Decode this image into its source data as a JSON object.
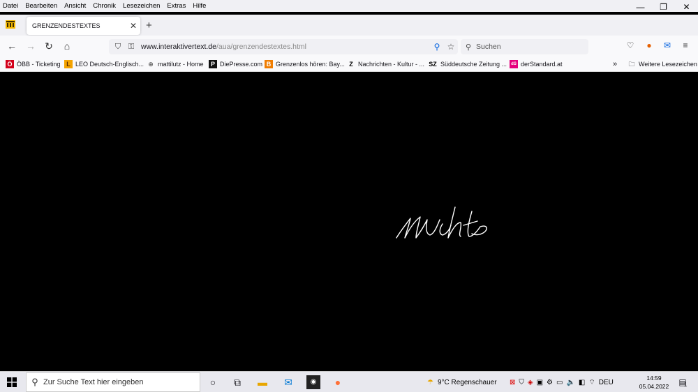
{
  "menubar": {
    "items": [
      "Datei",
      "Bearbeiten",
      "Ansicht",
      "Chronik",
      "Lesezeichen",
      "Extras",
      "Hilfe"
    ]
  },
  "window_controls": {
    "minimize": "—",
    "restore": "❐",
    "close": "✕"
  },
  "tab": {
    "title": "GRENZENDESTEXTES",
    "close": "✕",
    "new": "+"
  },
  "nav": {
    "url_domain": "www.interaktivertext.de",
    "url_path": "/aua/grenzendestextes.html",
    "search_placeholder": "Suchen"
  },
  "bookmarks": [
    {
      "label": "ÖBB - Ticketing",
      "icon": "obb-icon"
    },
    {
      "label": "LEO Deutsch-Englisch...",
      "icon": "leo-icon"
    },
    {
      "label": "mattilutz - Home",
      "icon": "globe-icon"
    },
    {
      "label": "DiePresse.com",
      "icon": "diepresse-icon"
    },
    {
      "label": "Grenzenlos hören: Bay...",
      "icon": "br-icon"
    },
    {
      "label": "Nachrichten - Kultur - ...",
      "icon": "zeit-icon"
    },
    {
      "label": "Süddeutsche Zeitung ...",
      "icon": "sz-icon"
    },
    {
      "label": "derStandard.at",
      "icon": "derstandard-icon"
    }
  ],
  "bookmarks_other": "Weitere Lesezeichen",
  "content": {
    "signature_text": "nichts"
  },
  "taskbar": {
    "search_placeholder": "Zur Suche Text hier eingeben",
    "weather": "9°C  Regenschauer",
    "language": "DEU",
    "time": "14:59",
    "date": "05.04.2022",
    "notification_count": "1"
  },
  "colors": {
    "chrome_bg": "#f0f0f4",
    "toolbar_bg": "#f9f9fb",
    "content_bg": "#000000",
    "accent": "#0060df"
  }
}
